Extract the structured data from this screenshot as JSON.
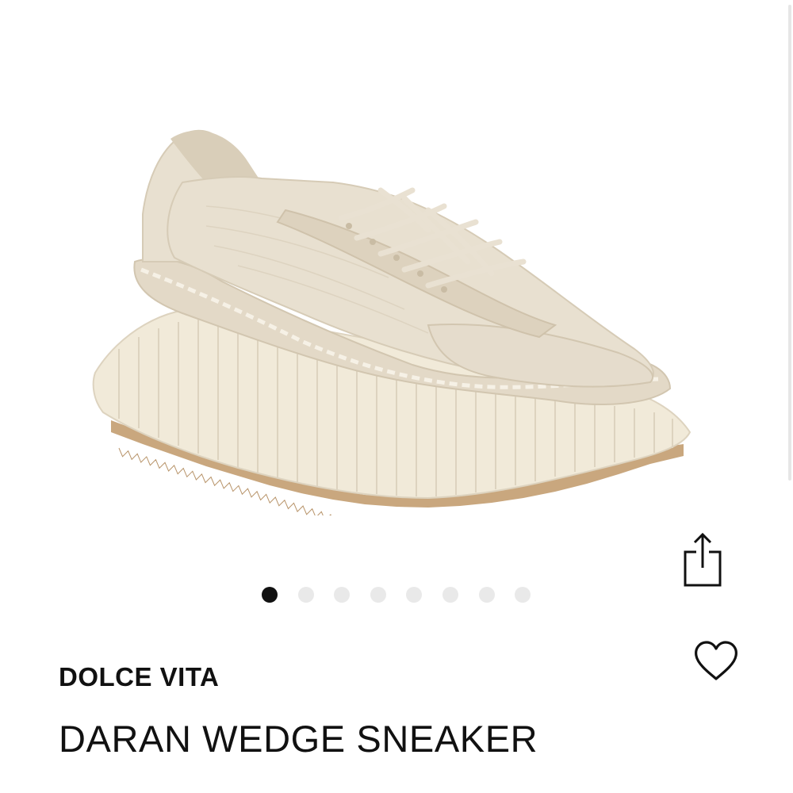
{
  "product": {
    "brand": "DOLCE VITA",
    "name": "DARAN WEDGE SNEAKER"
  },
  "gallery": {
    "image_count": 8,
    "active_index": 0
  },
  "icons": {
    "share": "share-icon",
    "wishlist": "heart-icon"
  },
  "colors": {
    "text": "#111111",
    "dot_active": "#111111",
    "dot_inactive": "#e9e9e9",
    "shoe_upper": "#e8e0d0",
    "shoe_sole": "#f1ead9",
    "gum_outsole": "#c9a77e"
  }
}
